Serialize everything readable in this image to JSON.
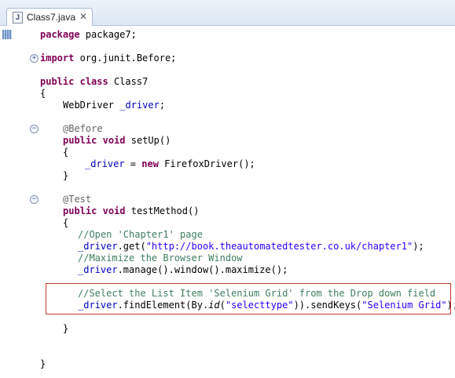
{
  "tab": {
    "title": "Class7.java",
    "close_glyph": "✕",
    "icon_letter": "J"
  },
  "code": {
    "l1": {
      "kw": "package",
      "rest": " package7;"
    },
    "l2": {
      "kw": "import",
      "rest": " org.junit.Before;"
    },
    "l3": {
      "kw1": "public",
      "kw2": "class",
      "rest": " Class7"
    },
    "l4": "{",
    "l5": {
      "type": "WebDriver ",
      "field": "_driver",
      "end": ";"
    },
    "l6": "@Before",
    "l7": {
      "kw1": "public",
      "kw2": "void",
      "rest": " setUp()"
    },
    "l8": "{",
    "l9": {
      "field": "_driver",
      "mid": " = ",
      "kw": "new",
      "rest": " FirefoxDriver();"
    },
    "l10": "}",
    "l11": "@Test",
    "l12": {
      "kw1": "public",
      "kw2": "void",
      "rest": " testMethod()"
    },
    "l13": "{",
    "l14": "//Open 'Chapter1' page",
    "l15": {
      "field": "_driver",
      "pre": ".get(",
      "str": "\"http://book.theautomatedtester.co.uk/chapter1\"",
      "post": ");"
    },
    "l16": "//Maximize the Browser Window",
    "l17": {
      "field": "_driver",
      "rest": ".manage().window().maximize();"
    },
    "l18": "//Select the List Item 'Selenium Grid' from the Drop down field",
    "l19": {
      "field": "_driver",
      "pre": ".findElement(By.",
      "method": "id",
      "open": "(",
      "str1": "\"selecttype\"",
      "mid": ")).sendKeys(",
      "str2": "\"Selenium Grid\"",
      "post": ");"
    },
    "l20": "}",
    "l21": "}"
  },
  "folds": {
    "expand": "+",
    "collapse": "−"
  }
}
